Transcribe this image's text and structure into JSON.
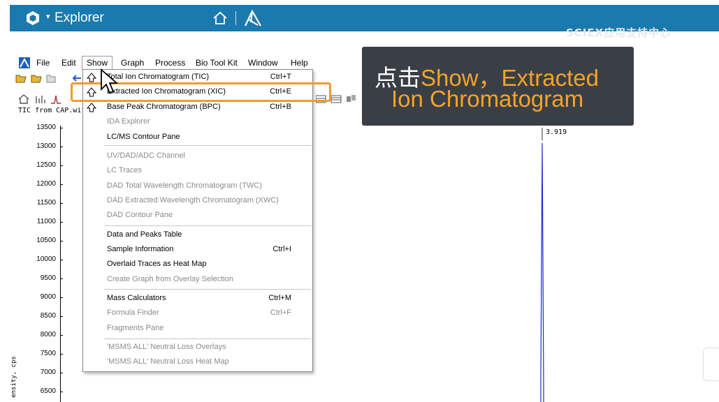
{
  "window": {
    "title": "Explorer"
  },
  "watermark": "SCIEX应用支持中心",
  "menubar": {
    "items": [
      "File",
      "Edit",
      "Show",
      "Graph",
      "Process",
      "Bio Tool Kit",
      "Window",
      "Help"
    ],
    "active": "Show"
  },
  "graph": {
    "title": "TIC from CAP.wif",
    "y_axis_label": "ensity, cps",
    "y_ticks": [
      "13500",
      "13000",
      "12500",
      "12000",
      "11500",
      "11000",
      "10500",
      "10000",
      "9500",
      "9000",
      "8500",
      "8000",
      "7500",
      "7000",
      "6500"
    ],
    "peak_label": "3.919",
    "trace_color": "#1a2ad6"
  },
  "show_menu": {
    "items": [
      {
        "label": "Total Ion Chromatogram (TIC)",
        "shortcut": "Ctrl+T",
        "enabled": true,
        "icon": "up-arrow-icon"
      },
      {
        "label": "Extracted Ion Chromatogram (XIC)",
        "shortcut": "Ctrl+E",
        "enabled": true,
        "icon": "up-arrow-icon"
      },
      {
        "label": "Base Peak Chromatogram (BPC)",
        "shortcut": "Ctrl+B",
        "enabled": true,
        "icon": "up-arrow-icon"
      },
      {
        "label": "IDA Explorer",
        "shortcut": "",
        "enabled": false
      },
      {
        "label": "LC/MS Contour Pane",
        "shortcut": "",
        "enabled": true
      },
      {
        "label": "UV/DAD/ADC Channel",
        "shortcut": "",
        "enabled": false
      },
      {
        "label": "LC Traces",
        "shortcut": "",
        "enabled": false
      },
      {
        "label": "DAD Total Wavelength Chromatogram (TWC)",
        "shortcut": "",
        "enabled": false
      },
      {
        "label": "DAD Extracted Wavelength Chromatogram (XWC)",
        "shortcut": "",
        "enabled": false
      },
      {
        "label": "DAD Contour Pane",
        "shortcut": "",
        "enabled": false
      },
      {
        "label": "Data and Peaks Table",
        "shortcut": "",
        "enabled": true
      },
      {
        "label": "Sample Information",
        "shortcut": "Ctrl+I",
        "enabled": true
      },
      {
        "label": "Overlaid Traces as Heat Map",
        "shortcut": "",
        "enabled": true
      },
      {
        "label": "Create Graph from Overlay Selection",
        "shortcut": "",
        "enabled": false
      },
      {
        "label": "Mass Calculators",
        "shortcut": "Ctrl+M",
        "enabled": true
      },
      {
        "label": "Formula Finder",
        "shortcut": "Ctrl+F",
        "enabled": false
      },
      {
        "label": "Fragments Pane",
        "shortcut": "",
        "enabled": false
      },
      {
        "label": "'MSMS ALL' Neutral Loss Overlays",
        "shortcut": "",
        "enabled": false
      },
      {
        "label": "'MSMS ALL' Neutral Loss Heat Map",
        "shortcut": "",
        "enabled": false
      }
    ],
    "highlighted": "Extracted Ion Chromatogram (XIC)"
  },
  "callout": {
    "prefix": "点击",
    "highlight": "Show，Extracted",
    "line2": "Ion Chromatogram",
    "prefix_color": "#ffffff",
    "highlight_color": "#f5a32a"
  },
  "colors": {
    "topbar": "#1a7aad",
    "highlight_border": "#f29a2e",
    "callout_bg": "#3a3f45"
  }
}
